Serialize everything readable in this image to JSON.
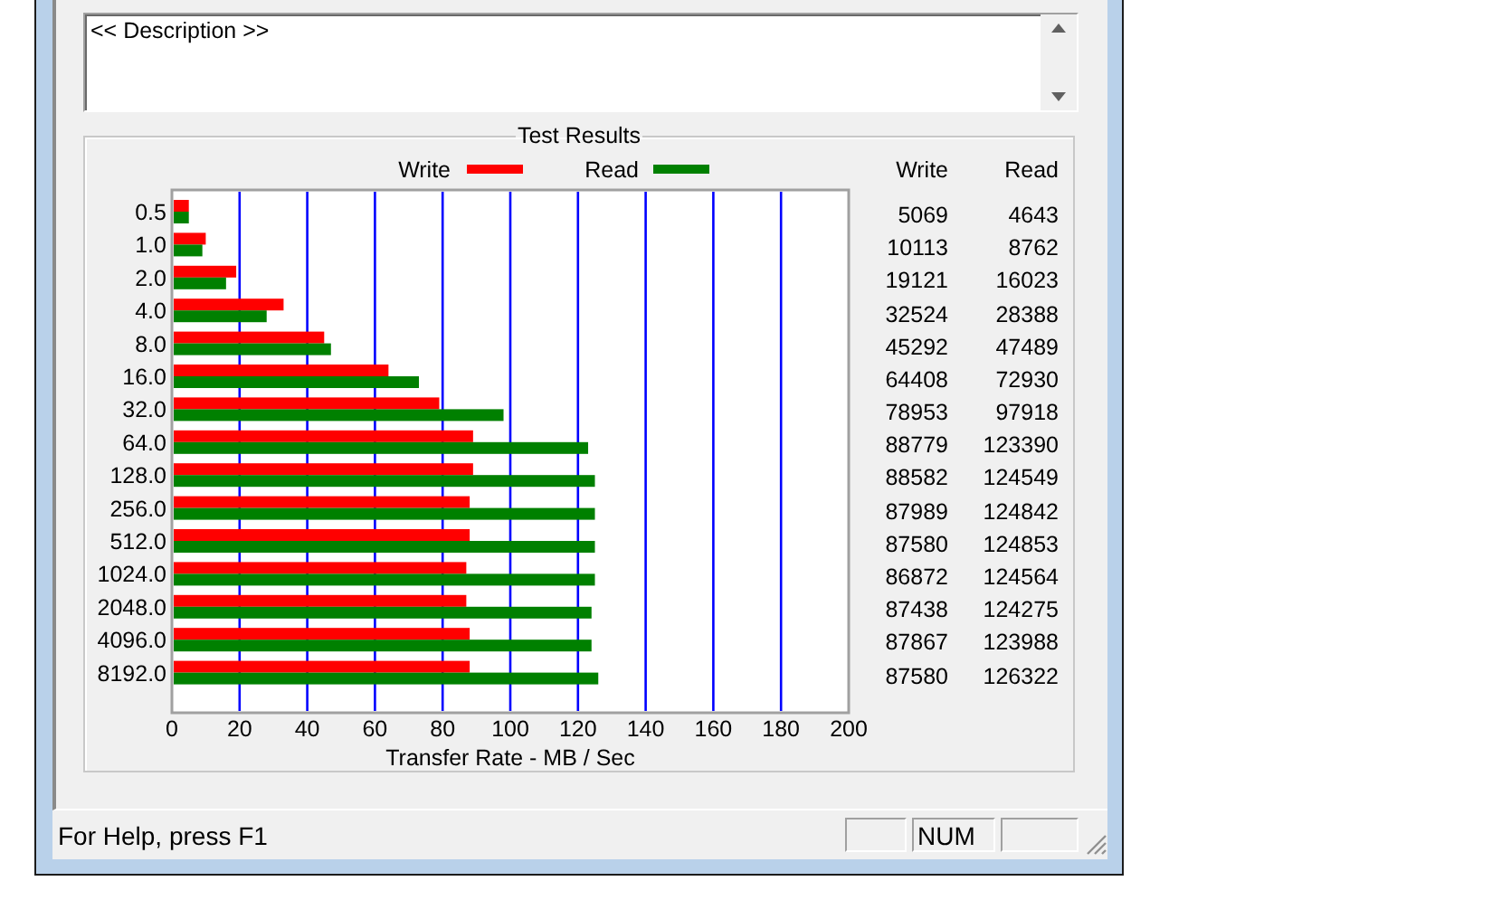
{
  "description": {
    "value": "<< Description >>"
  },
  "test_results": {
    "title": "Test Results",
    "chart_data": {
      "type": "bar",
      "orientation": "horizontal",
      "xlabel": "Transfer Rate - MB / Sec",
      "categories": [
        "0.5",
        "1.0",
        "2.0",
        "4.0",
        "8.0",
        "16.0",
        "32.0",
        "64.0",
        "128.0",
        "256.0",
        "512.0",
        "1024.0",
        "2048.0",
        "4096.0",
        "8192.0"
      ],
      "series": [
        {
          "name": "Write",
          "color": "#ff0000",
          "values": [
            5,
            10,
            19,
            33,
            45,
            64,
            79,
            89,
            89,
            88,
            88,
            87,
            87,
            88,
            88
          ]
        },
        {
          "name": "Read",
          "color": "#008000",
          "values": [
            5,
            9,
            16,
            28,
            47,
            73,
            98,
            123,
            125,
            125,
            125,
            125,
            124,
            124,
            126
          ]
        }
      ],
      "grid": {
        "x": true,
        "color": "#0000ff"
      },
      "legend": true,
      "xlim": [
        0,
        200
      ],
      "xticks": [
        0,
        20,
        40,
        60,
        80,
        100,
        120,
        140,
        160,
        180,
        200
      ]
    },
    "table": {
      "columns": [
        "Write",
        "Read"
      ],
      "rows": [
        [
          "5069",
          "4643"
        ],
        [
          "10113",
          "8762"
        ],
        [
          "19121",
          "16023"
        ],
        [
          "32524",
          "28388"
        ],
        [
          "45292",
          "47489"
        ],
        [
          "64408",
          "72930"
        ],
        [
          "78953",
          "97918"
        ],
        [
          "88779",
          "123390"
        ],
        [
          "88582",
          "124549"
        ],
        [
          "87989",
          "124842"
        ],
        [
          "87580",
          "124853"
        ],
        [
          "86872",
          "124564"
        ],
        [
          "87438",
          "124275"
        ],
        [
          "87867",
          "123988"
        ],
        [
          "87580",
          "126322"
        ]
      ]
    }
  },
  "status_bar": {
    "text": "For Help, press F1",
    "num_indicator": "NUM"
  }
}
